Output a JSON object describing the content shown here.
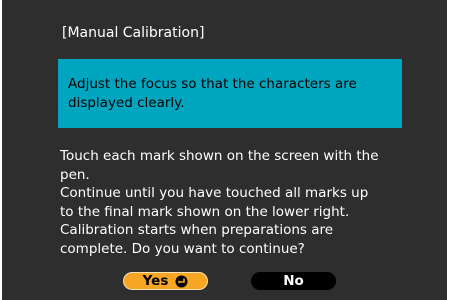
{
  "dialog": {
    "title": "[Manual Calibration]",
    "notice": "Adjust the focus so that the characters are\ndisplayed clearly.",
    "instructions": "Touch each mark shown on the screen with the\npen.\nContinue until you have touched all marks up\nto the final mark shown on the lower right.\nCalibration starts when preparations are\ncomplete. Do you want to continue?",
    "buttons": {
      "yes_label": "Yes",
      "yes_icon": "enter-icon",
      "no_label": "No"
    }
  },
  "colors": {
    "background": "#2e2e2e",
    "notice_bg": "#00a6c0",
    "yes_bg": "#f7a623",
    "no_bg": "#000000"
  }
}
